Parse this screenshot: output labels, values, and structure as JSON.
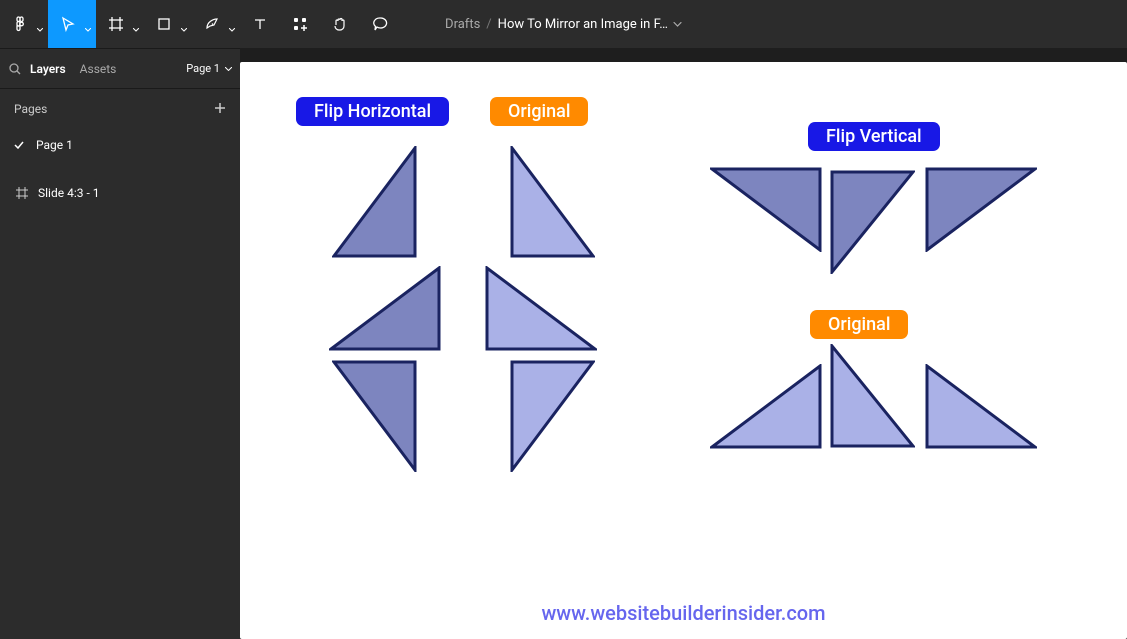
{
  "toolbar": {
    "breadcrumb_drafts": "Drafts",
    "breadcrumb_title": "How To Mirror an Image in F…"
  },
  "sidebar": {
    "tabs": {
      "layers": "Layers",
      "assets": "Assets"
    },
    "page_selector": "Page 1",
    "pages_header": "Pages",
    "pages": [
      {
        "name": "Page 1",
        "selected": true
      }
    ],
    "layers": [
      {
        "name": "Slide 4:3 - 1"
      }
    ]
  },
  "canvas": {
    "labels": {
      "flip_horizontal": "Flip Horizontal",
      "original_1": "Original",
      "flip_vertical": "Flip Vertical",
      "original_2": "Original"
    },
    "footer_url": "www.websitebuilderinsider.com",
    "colors": {
      "label_blue": "#1818e6",
      "label_orange": "#ff8a00",
      "triangle_fill_dark": "#7d85bf",
      "triangle_fill_light": "#aab1e7",
      "triangle_stroke": "#1a2360"
    }
  }
}
